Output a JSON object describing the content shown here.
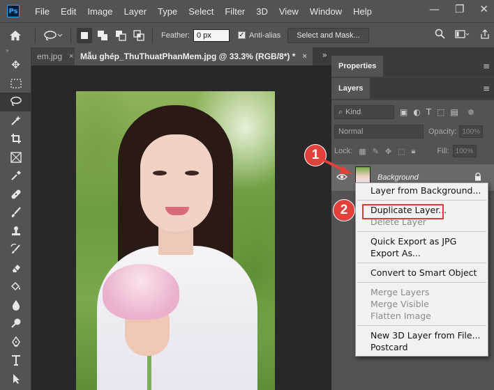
{
  "app": {
    "logo_text": "Ps"
  },
  "menu": [
    "File",
    "Edit",
    "Image",
    "Layer",
    "Type",
    "Select",
    "Filter",
    "3D",
    "View",
    "Window",
    "Help"
  ],
  "window_controls": {
    "minimize": "—",
    "restore": "❐",
    "close": "✕"
  },
  "options": {
    "feather_label": "Feather:",
    "feather_value": "0 px",
    "antialias_label": "Anti-alias",
    "antialias_checked": true,
    "select_mask_label": "Select and Mask..."
  },
  "tabs": {
    "inactive_label": "em.jpg",
    "active_label": "Mẫu ghép_ThuThuatPhanMem.jpg @ 33.3% (RGB/8*) *",
    "close_glyph": "×",
    "overflow_glyph": "»"
  },
  "panels": {
    "properties_tab": "Properties",
    "layers_tab": "Layers",
    "filter_kind": "Kind",
    "blend_mode": "Normal",
    "opacity_label": "Opacity:",
    "opacity_value": "100%",
    "lock_label": "Lock:",
    "fill_label": "Fill:",
    "fill_value": "100%",
    "layer_name": "Background"
  },
  "context_menu": {
    "groups": [
      [
        "Layer from Background..."
      ],
      [
        "Duplicate Layer...",
        "Delete Layer"
      ],
      [
        "Quick Export as JPG",
        "Export As..."
      ],
      [
        "Convert to Smart Object"
      ],
      [
        "Merge Layers",
        "Merge Visible",
        "Flatten Image"
      ],
      [
        "New 3D Layer from File...",
        "Postcard"
      ]
    ],
    "disabled": [
      "Delete Layer",
      "Merge Layers",
      "Merge Visible",
      "Flatten Image"
    ]
  },
  "annotations": {
    "step1": "1",
    "step2": "2",
    "color": "#e0413b"
  },
  "colors": {
    "ui_bg": "#535353",
    "canvas_bg": "#282828",
    "menu_bg": "#f2f2f2",
    "highlight": "#e03b3b"
  }
}
